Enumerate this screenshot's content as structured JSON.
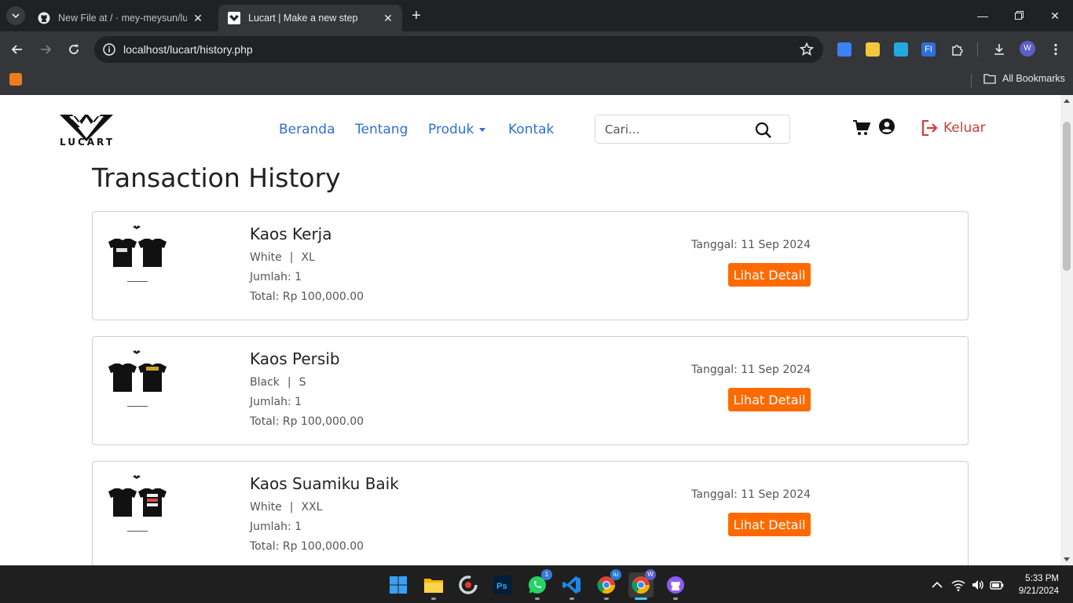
{
  "browser": {
    "tabs": [
      {
        "title": "New File at / · mey-meysun/lucart",
        "active": false,
        "favicon": "github-icon"
      },
      {
        "title": "Lucart | Make a new step",
        "active": true,
        "favicon": "lucart-favicon"
      }
    ],
    "url": "localhost/lucart/history.php",
    "bookmarks_all_label": "All Bookmarks",
    "profile_initial": "W"
  },
  "site": {
    "logo_text": "LUCART",
    "nav": [
      {
        "label": "Beranda"
      },
      {
        "label": "Tentang"
      },
      {
        "label": "Produk",
        "dropdown": true
      },
      {
        "label": "Kontak"
      }
    ],
    "search_placeholder": "Cari...",
    "logout_label": "Keluar",
    "accent_color": "#2f6fd6",
    "button_color": "#ff6a00",
    "logout_color": "#d63b3b"
  },
  "page": {
    "title": "Transaction History",
    "transactions": [
      {
        "name": "Kaos Kerja",
        "color": "White",
        "size": "XL",
        "qty_text": "Jumlah: 1",
        "total_text": "Total: Rp 100,000.00",
        "date_text": "Tanggal: 11 Sep 2024",
        "button_label": "Lihat Detail"
      },
      {
        "name": "Kaos Persib",
        "color": "Black",
        "size": "S",
        "qty_text": "Jumlah: 1",
        "total_text": "Total: Rp 100,000.00",
        "date_text": "Tanggal: 11 Sep 2024",
        "button_label": "Lihat Detail"
      },
      {
        "name": "Kaos Suamiku Baik",
        "color": "White",
        "size": "XXL",
        "qty_text": "Jumlah: 1",
        "total_text": "Total: Rp 100,000.00",
        "date_text": "Tanggal: 11 Sep 2024",
        "button_label": "Lihat Detail"
      }
    ]
  },
  "taskbar": {
    "apps": [
      "windows-start-icon",
      "file-explorer-icon",
      "ccleaner-icon",
      "photoshop-icon",
      "whatsapp-icon",
      "vscode-icon",
      "chrome-profile-icon",
      "chrome-active-icon",
      "github-desktop-icon"
    ],
    "whatsapp_badge": "1",
    "time": "5:33 PM",
    "date": "9/21/2024"
  }
}
